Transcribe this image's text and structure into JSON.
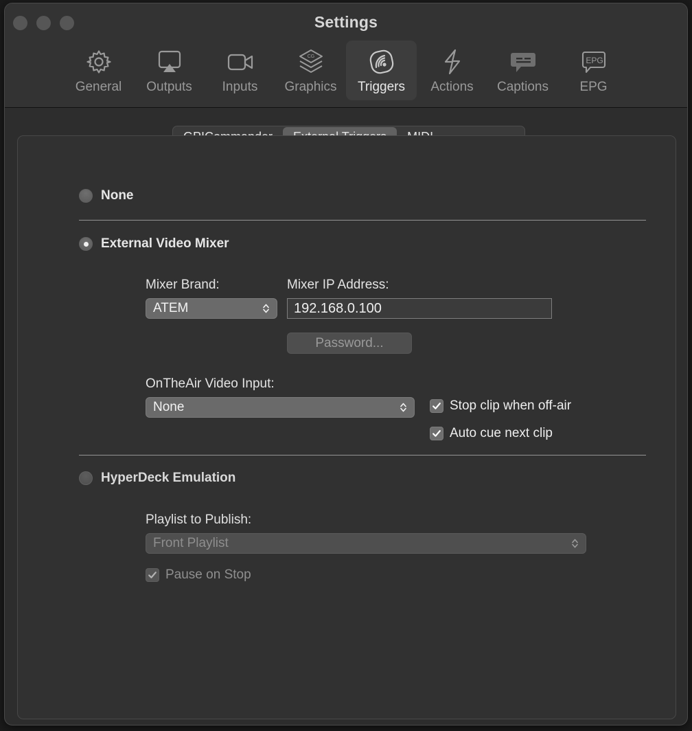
{
  "window": {
    "title": "Settings",
    "traffic_lights": [
      "close",
      "minimize",
      "zoom"
    ]
  },
  "toolbar": {
    "items": [
      {
        "label": "General",
        "icon": "gear-icon",
        "selected": false
      },
      {
        "label": "Outputs",
        "icon": "airplay-icon",
        "selected": false
      },
      {
        "label": "Inputs",
        "icon": "video-camera-icon",
        "selected": false
      },
      {
        "label": "Graphics",
        "icon": "cg-layers-icon",
        "selected": false
      },
      {
        "label": "Triggers",
        "icon": "trigger-wave-icon",
        "selected": true
      },
      {
        "label": "Actions",
        "icon": "lightning-icon",
        "selected": false
      },
      {
        "label": "Captions",
        "icon": "caption-bubble-icon",
        "selected": false
      },
      {
        "label": "EPG",
        "icon": "epg-bubble-icon",
        "selected": false
      }
    ]
  },
  "tabs": [
    {
      "label": "GPICommander",
      "active": false
    },
    {
      "label": "External Triggers",
      "active": true
    },
    {
      "label": "MIDI",
      "active": false
    }
  ],
  "content": {
    "options": {
      "none": {
        "label": "None",
        "selected": false
      },
      "external_video_mixer": {
        "label": "External Video Mixer",
        "selected": true
      },
      "hyperdeck_emulation": {
        "label": "HyperDeck Emulation",
        "selected": false
      }
    },
    "mixer_brand": {
      "label": "Mixer Brand:",
      "value": "ATEM",
      "options": [
        "ATEM"
      ]
    },
    "mixer_ip": {
      "label": "Mixer IP Address:",
      "value": "192.168.0.100",
      "placeholder": "192.168.0.100"
    },
    "password_button": {
      "label": "Password..."
    },
    "video_input": {
      "label": "OnTheAir Video Input:",
      "value": "None",
      "options": [
        "None"
      ]
    },
    "checkboxes": [
      {
        "label": "Stop clip when off-air",
        "checked": true,
        "enabled": true
      },
      {
        "label": "Auto cue next clip",
        "checked": true,
        "enabled": true
      }
    ],
    "playlist": {
      "label": "Playlist to Publish:",
      "value": "Front Playlist",
      "options": [
        "Front Playlist"
      ],
      "enabled": false
    },
    "pause_on_stop": {
      "label": "Pause on Stop",
      "checked": true,
      "enabled": false
    }
  },
  "colors": {
    "window_bg": "#2d2d2d",
    "titlebar_bg": "#333333",
    "panel_bg": "#313131",
    "selected_tab_bg": "#616161",
    "selected_toolbar_bg": "#3d3d3d",
    "text_primary": "#e8e8e8",
    "text_secondary": "#999999",
    "text_disabled": "#8f8f8f",
    "separator": "#949494",
    "field_bg": "#3b3b3b",
    "popup_bg": "#6a6a6a"
  }
}
